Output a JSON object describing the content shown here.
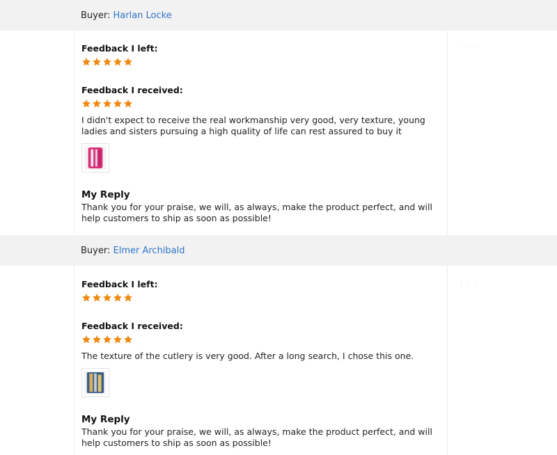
{
  "reviews": [
    {
      "buyer_label": "Buyer:",
      "buyer_name": "Harlan Locke",
      "feedback_left_label": "Feedback I left:",
      "feedback_left_stars": 5,
      "feedback_received_label": "Feedback I received:",
      "feedback_received_stars": 5,
      "received_text": "I didn't expect to receive the real workmanship very good, very texture, young ladies and sisters pursuing a high quality of life can rest assured to buy it",
      "reply_label": "My Reply",
      "reply_text": "Thank you for your praise, we will, as always, make the product perfect, and will help customers to ship as soon as possible!"
    },
    {
      "buyer_label": "Buyer:",
      "buyer_name": "Elmer Archibald",
      "feedback_left_label": "Feedback I left:",
      "feedback_left_stars": 5,
      "feedback_received_label": "Feedback I received:",
      "feedback_received_stars": 5,
      "received_text": "The texture of the cutlery is very good. After a long search, I chose this one.",
      "reply_label": "My Reply",
      "reply_text": "Thank you for your praise, we will, as always, make the product perfect, and will help customers to ship as soon as possible!"
    }
  ],
  "colors": {
    "star": "#f0890f",
    "link": "#2f74c8",
    "bar_bg": "#f2f2f2"
  },
  "icons": {
    "rating_star": "star-icon"
  }
}
